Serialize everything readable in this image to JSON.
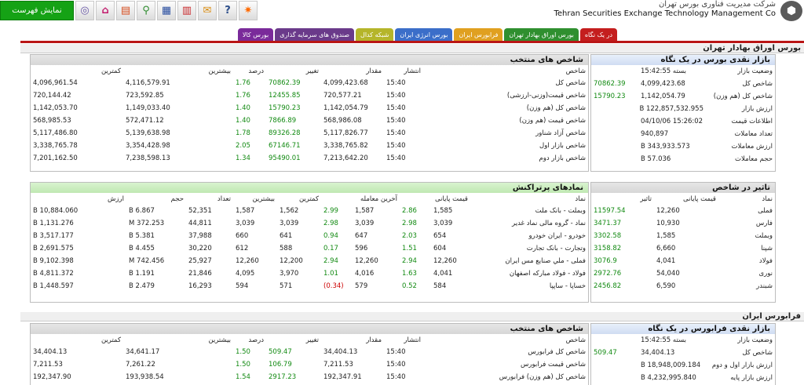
{
  "toolbar": {
    "fullscreen_label": "نمایش فهرست",
    "icons": [
      "globe-icon",
      "home-icon",
      "calculator-icon",
      "search-icon",
      "chart-icon",
      "books-icon",
      "chat-icon",
      "help-icon",
      "new-icon"
    ]
  },
  "company": {
    "name_fa": "شرکت مدیریت فناوری بورس تهران",
    "name_en": "Tehran Securities Exchange Technology Management Co"
  },
  "tabs": [
    {
      "label": "در یک نگاه",
      "color": "#c41e1e"
    },
    {
      "label": "بورس اوراق بهادار تهران",
      "color": "#2f8f2f"
    },
    {
      "label": "فرابورس ایران",
      "color": "#e0a020"
    },
    {
      "label": "بورس انرژی ایران",
      "color": "#3b6ec9"
    },
    {
      "label": "شبکه کدال",
      "color": "#b5b52a"
    },
    {
      "label": "صندوق های سرمایه گذاری",
      "color": "#6a3a8a"
    },
    {
      "label": "بورس کالا",
      "color": "#7a2a9a"
    }
  ],
  "tse": {
    "section_title": "بورس اوراق بهادار تهران",
    "market_panel": {
      "title": "بازار نقدی بورس در یک نگاه",
      "rows": [
        {
          "label": "وضعیت بازار",
          "value": "بسته 15:42:55",
          "change": ""
        },
        {
          "label": "شاخص کل",
          "value": "4,099,423.68",
          "change": "70862.39"
        },
        {
          "label": "شاخص کل (هم وزن)",
          "value": "1,142,054.79",
          "change": "15790.23"
        },
        {
          "label": "ارزش بازار",
          "value": "122,857,532.955 B",
          "change": ""
        },
        {
          "label": "اطلاعات قیمت",
          "value": "15:26:02 04/10/06",
          "change": ""
        },
        {
          "label": "تعداد معاملات",
          "value": "940,897",
          "change": ""
        },
        {
          "label": "ارزش معاملات",
          "value": "343,933.573 B",
          "change": ""
        },
        {
          "label": "حجم معاملات",
          "value": "57.036 B",
          "change": ""
        }
      ]
    },
    "indices_panel": {
      "title": "شاخص های منتخب",
      "headers": [
        "شاخص",
        "انتشار",
        "مقدار",
        "تغییر",
        "درصد",
        "بیشترین",
        "کمترین"
      ],
      "rows": [
        [
          "شاخص کل",
          "15:40",
          "4,099,423.68",
          "70862.39",
          "1.76",
          "4,116,579.91",
          "4,096,961.54"
        ],
        [
          "شاخص قیمت(وزنی-ارزشی)",
          "15:40",
          "720,577.21",
          "12455.85",
          "1.76",
          "723,592.85",
          "720,144.42"
        ],
        [
          "شاخص کل (هم وزن)",
          "15:40",
          "1,142,054.79",
          "15790.23",
          "1.40",
          "1,149,033.40",
          "1,142,053.70"
        ],
        [
          "شاخص قیمت (هم وزن)",
          "15:40",
          "568,986.08",
          "7866.89",
          "1.40",
          "572,471.12",
          "568,985.53"
        ],
        [
          "شاخص آزاد شناور",
          "15:40",
          "5,117,826.77",
          "89326.28",
          "1.78",
          "5,139,638.98",
          "5,117,486.80"
        ],
        [
          "شاخص بازار اول",
          "15:40",
          "3,338,765.82",
          "67146.71",
          "2.05",
          "3,354,428.98",
          "3,338,765.78"
        ],
        [
          "شاخص بازار دوم",
          "15:40",
          "7,213,642.20",
          "95490.01",
          "1.34",
          "7,238,598.13",
          "7,201,162.50"
        ]
      ]
    },
    "impact_panel": {
      "title": "تاثیر در شاخص",
      "headers": [
        "نماد",
        "قیمت پایانی",
        "تاثیر"
      ],
      "rows": [
        [
          "فملی",
          "12,260",
          "11597.54"
        ],
        [
          "فارس",
          "10,930",
          "3471.37"
        ],
        [
          "وبملت",
          "1,585",
          "3302.58"
        ],
        [
          "شپنا",
          "6,660",
          "3158.82"
        ],
        [
          "فولاد",
          "4,041",
          "3076.9"
        ],
        [
          "نوری",
          "54,040",
          "2972.76"
        ],
        [
          "شبندر",
          "6,590",
          "2456.82"
        ]
      ]
    },
    "top_panel": {
      "title": "نمادهای پرتراکنش",
      "headers": [
        "نماد",
        "قیمت پایانی",
        "",
        "آخرین معامله",
        "",
        "کمترین",
        "بیشترین",
        "تعداد",
        "حجم",
        "ارزش"
      ],
      "rows": [
        [
          "وبملت - بانک ملت",
          "1,585",
          "2.86",
          "1,587",
          "2.99",
          "1,562",
          "1,587",
          "52,351",
          "6.867 B",
          "10,884.060 B"
        ],
        [
          "نماد - گروه مالی نماد غدیر",
          "3,039",
          "2.98",
          "3,039",
          "2.98",
          "3,039",
          "3,039",
          "44,811",
          "372.253 M",
          "1,131.276 B"
        ],
        [
          "خودرو - ایران خودرو",
          "654",
          "2.03",
          "647",
          "0.94",
          "641",
          "660",
          "37,988",
          "5.381 B",
          "3,517.177 B"
        ],
        [
          "وتجارت - بانک تجارت",
          "604",
          "1.51",
          "596",
          "0.17",
          "588",
          "612",
          "30,220",
          "4.455 B",
          "2,691.575 B"
        ],
        [
          "فملی - ملي صنايع مس ايران",
          "12,260",
          "2.94",
          "12,260",
          "2.94",
          "12,200",
          "12,260",
          "25,927",
          "742.456 M",
          "9,102.398 B"
        ],
        [
          "فولاد - فولاد مباركه اصفهان",
          "4,041",
          "1.63",
          "4,016",
          "1.01",
          "3,970",
          "4,095",
          "21,846",
          "1.191 B",
          "4,811.372 B"
        ],
        [
          "خساپا - ساپپا",
          "584",
          "0.52",
          "579",
          "(0.34)",
          "571",
          "594",
          "16,293",
          "2.479 B",
          "1,448.597 B"
        ]
      ]
    }
  },
  "ifb": {
    "section_title": "فرابورس ایران",
    "market_panel": {
      "title": "بازار نقدی فرابورس در یک نگاه",
      "rows": [
        {
          "label": "وضعیت بازار",
          "value": "بسته 15:42:55",
          "change": ""
        },
        {
          "label": "شاخص کل",
          "value": "34,404.13",
          "change": "509.47"
        },
        {
          "label": "ارزش بازار اول و دوم",
          "value": "18,948,009.184 B",
          "change": ""
        },
        {
          "label": "ارزش بازار پایه",
          "value": "4,232,995.840 B",
          "change": ""
        }
      ]
    },
    "indices_panel": {
      "title": "شاخص های منتخب",
      "headers": [
        "شاخص",
        "انتشار",
        "مقدار",
        "تغییر",
        "درصد",
        "بیشترین",
        "کمترین"
      ],
      "rows": [
        [
          "شاخص کل فرابورس",
          "15:40",
          "34,404.13",
          "509.47",
          "1.50",
          "34,641.17",
          "34,404.13"
        ],
        [
          "شاخص قیمت فرابورس",
          "15:40",
          "7,211.53",
          "106.79",
          "1.50",
          "7,261.22",
          "7,211.53"
        ],
        [
          "شاخص کل (هم وزن) فرابورس",
          "15:40",
          "192,347.91",
          "2917.23",
          "1.54",
          "193,938.54",
          "192,347.90"
        ]
      ]
    }
  },
  "colors": {
    "green": "#128a12",
    "red": "#cc0000",
    "accent": "#b91515"
  }
}
